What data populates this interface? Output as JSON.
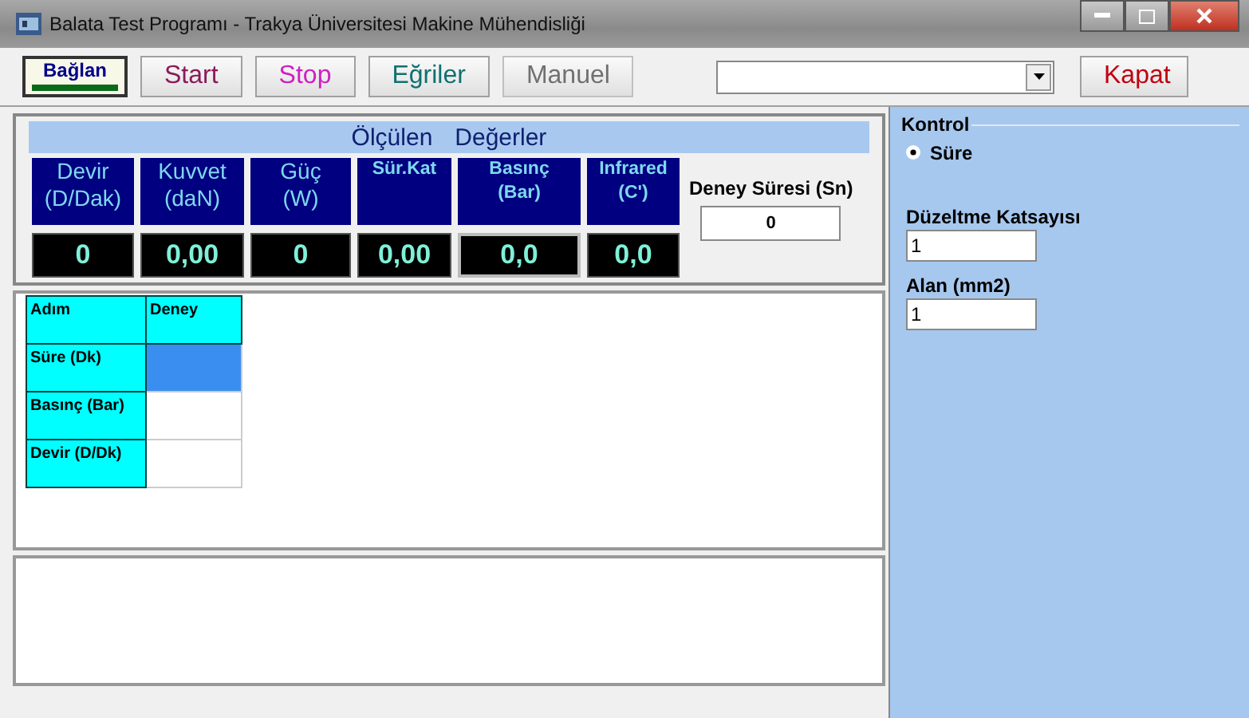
{
  "window": {
    "title": "Balata Test Programı - Trakya Üniversitesi Makine Mühendisliği"
  },
  "toolbar": {
    "buttons": [
      {
        "label": "Bağlan",
        "kind": "connect",
        "color": "#00008b",
        "disabled": false
      },
      {
        "label": "Start",
        "kind": "plain",
        "color": "#8b1a5a",
        "disabled": false
      },
      {
        "label": "Stop",
        "kind": "plain",
        "color": "#d020c0",
        "disabled": false
      },
      {
        "label": "Eğriler",
        "kind": "plain",
        "color": "#107070",
        "disabled": false
      },
      {
        "label": "Manuel",
        "kind": "plain",
        "color": "#707070",
        "disabled": true
      }
    ],
    "close_button": {
      "label": "Kapat"
    }
  },
  "measurements": {
    "title_parts": [
      "Ölçülen",
      "Değerler"
    ],
    "gauges": [
      {
        "label": "Devir\n(D/Dak)",
        "value": "0",
        "kind": "large",
        "selected": false
      },
      {
        "label": "Kuvvet\n(daN)",
        "value": "0,00",
        "kind": "large",
        "selected": false
      },
      {
        "label": "Güç\n(W)",
        "value": "0",
        "kind": "large",
        "selected": false
      },
      {
        "label": "Sür.Kat",
        "value": "0,00",
        "kind": "small",
        "selected": false
      },
      {
        "label": "Basınç\n(Bar)",
        "value": "0,0",
        "kind": "small",
        "selected": true
      },
      {
        "label": "Infrared\n(C')",
        "value": "0,0",
        "kind": "small",
        "selected": false
      }
    ],
    "duration": {
      "label": "Deney Süresi (Sn)",
      "value": "0"
    }
  },
  "grid": {
    "columns": [
      "Adım",
      "Deney"
    ],
    "rows": [
      {
        "label": "Süre (Dk)",
        "selected": true
      },
      {
        "label": "Basınç (Bar)",
        "selected": false
      },
      {
        "label": "Devir (D/Dk)",
        "selected": false
      }
    ]
  },
  "control": {
    "title": "Kontrol",
    "options": [
      {
        "label": "Süre",
        "selected": true
      }
    ],
    "fields": [
      {
        "label": "Düzeltme Katsayısı",
        "value": "1"
      },
      {
        "label": "Alan (mm2)",
        "value": "1"
      }
    ]
  }
}
